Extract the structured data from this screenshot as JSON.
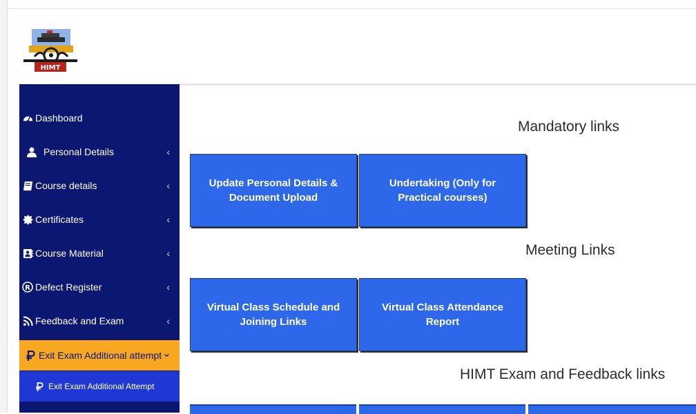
{
  "logo": {
    "text": "HIMT"
  },
  "sidebar": {
    "items": [
      {
        "label": "Dashboard",
        "icon": "dashboard-icon",
        "expandable": false
      },
      {
        "label": "Personal Details",
        "icon": "user-icon",
        "expandable": true
      },
      {
        "label": "Course details",
        "icon": "book-icon",
        "expandable": true
      },
      {
        "label": "Certificates",
        "icon": "badge-icon",
        "expandable": true
      },
      {
        "label": "Course Material",
        "icon": "address-book-icon",
        "expandable": true
      },
      {
        "label": "Defect Register",
        "icon": "registered-icon",
        "expandable": true
      },
      {
        "label": "Feedback and Exam",
        "icon": "rss-icon",
        "expandable": true
      },
      {
        "label": "Exit Exam Additional attempt",
        "icon": "ruble-icon",
        "expandable": true,
        "expanded": true,
        "active": true
      }
    ],
    "submenu": [
      {
        "label": "Exit Exam Additional Attempt",
        "icon": "ruble-icon"
      }
    ],
    "chevron_closed": "‹",
    "chevron_open": "⌄"
  },
  "sections": {
    "mandatory": {
      "title": "Mandatory links",
      "tiles": [
        "Update Personal Details & Document Upload",
        "Undertaking (Only for Practical courses)"
      ]
    },
    "meeting": {
      "title": "Meeting Links",
      "tiles": [
        "Virtual Class Schedule and Joining Links",
        "Virtual Class Attendance Report"
      ]
    },
    "exam": {
      "title": "HIMT Exam and Feedback links"
    }
  },
  "colors": {
    "sidebar_bg": "#0b1771",
    "active_bg": "#f7a720",
    "submenu_bg": "#1f37d3",
    "tile_bg": "#2d68ea"
  }
}
